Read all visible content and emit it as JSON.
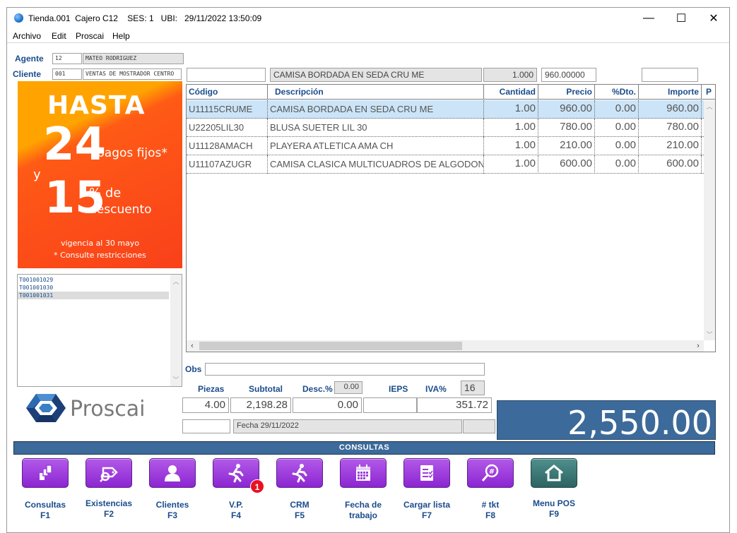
{
  "titlebar": {
    "title": "Tienda.001  Cajero C12    SES: 1   UBI:   29/11/2022 13:50:09",
    "minimize": "—",
    "maximize": "☐",
    "close": "✕"
  },
  "menu": [
    "Archivo",
    "Edit",
    "Proscai",
    "Help"
  ],
  "agent": {
    "label": "Agente",
    "code": "12",
    "name": "MATEO RODRIGUEZ"
  },
  "client": {
    "label": "Cliente",
    "code": "001",
    "name": "VENTAS DE MOSTRADOR CENTRO"
  },
  "entry": {
    "code": "",
    "description": "CAMISA BORDADA EN SEDA CRU ME",
    "quantity": "1.000",
    "price": "960.00000",
    "extra": ""
  },
  "promo": {
    "line1": "HASTA",
    "number1": "24",
    "line2": "pagos fijos*",
    "conj": "y",
    "number2": "15",
    "pct": "% de",
    "line3": "descuento",
    "validity": "vigencia al 30 mayo",
    "note": "* Consulte restricciones"
  },
  "tickets": [
    "T001001029",
    "T001001030",
    "T001001031"
  ],
  "grid": {
    "columns": [
      "Código",
      "Descripción",
      "Cantidad",
      "Precio",
      "%Dto.",
      "Importe",
      "P"
    ],
    "rows": [
      [
        "U11115CRUME",
        "CAMISA BORDADA EN SEDA CRU ME",
        "1.00",
        "960.00",
        "0.00",
        "960.00"
      ],
      [
        "U22205LIL30",
        "BLUSA SUETER LIL 30",
        "1.00",
        "780.00",
        "0.00",
        "780.00"
      ],
      [
        "U11128AMACH",
        "PLAYERA ATLETICA AMA CH",
        "1.00",
        "210.00",
        "0.00",
        "210.00"
      ],
      [
        "U11107AZUGR",
        "CAMISA CLASICA MULTICUADROS DE ALGODON AZ",
        "1.00",
        "600.00",
        "0.00",
        "600.00"
      ]
    ]
  },
  "obs": {
    "label": "Obs",
    "value": ""
  },
  "totals": {
    "piezas_label": "Piezas",
    "subtotal_label": "Subtotal",
    "desc_label": "Desc.%",
    "desc_pct": "0.00",
    "ieps_label": "IEPS",
    "iva_label": "IVA%",
    "iva_pct": "16",
    "piezas": "4.00",
    "subtotal": "2,198.28",
    "descuento": "0.00",
    "ieps": "",
    "iva": "351.72",
    "total": "2,550.00",
    "fecha": "Fecha 29/11/2022"
  },
  "logo": {
    "text": "Proscai"
  },
  "consultas_bar": "CONSULTAS",
  "fkeys": [
    {
      "label": "Consultas",
      "key": "F1",
      "icon": "consultas-icon"
    },
    {
      "label": "Existencias",
      "key": "F2",
      "icon": "existencias-icon"
    },
    {
      "label": "Clientes",
      "key": "F3",
      "icon": "clientes-icon"
    },
    {
      "label": "V.P.",
      "key": "F4",
      "icon": "vp-icon"
    },
    {
      "label": "CRM",
      "key": "F5",
      "icon": "crm-icon"
    },
    {
      "label": "Fecha de",
      "key": "trabajo",
      "icon": "calendar-icon"
    },
    {
      "label": "Cargar lista",
      "key": "F7",
      "icon": "checklist-icon"
    },
    {
      "label": "# tkt",
      "key": "F8",
      "icon": "search-ticket-icon"
    },
    {
      "label": "Menu POS",
      "key": "F9",
      "icon": "home-icon"
    }
  ],
  "badge": "1",
  "colors": {
    "accent": "#3c6a9a",
    "label": "#1a4c8c",
    "button": "#9b3fdc",
    "home_button": "#3e7c7a",
    "badge": "#e81123"
  }
}
